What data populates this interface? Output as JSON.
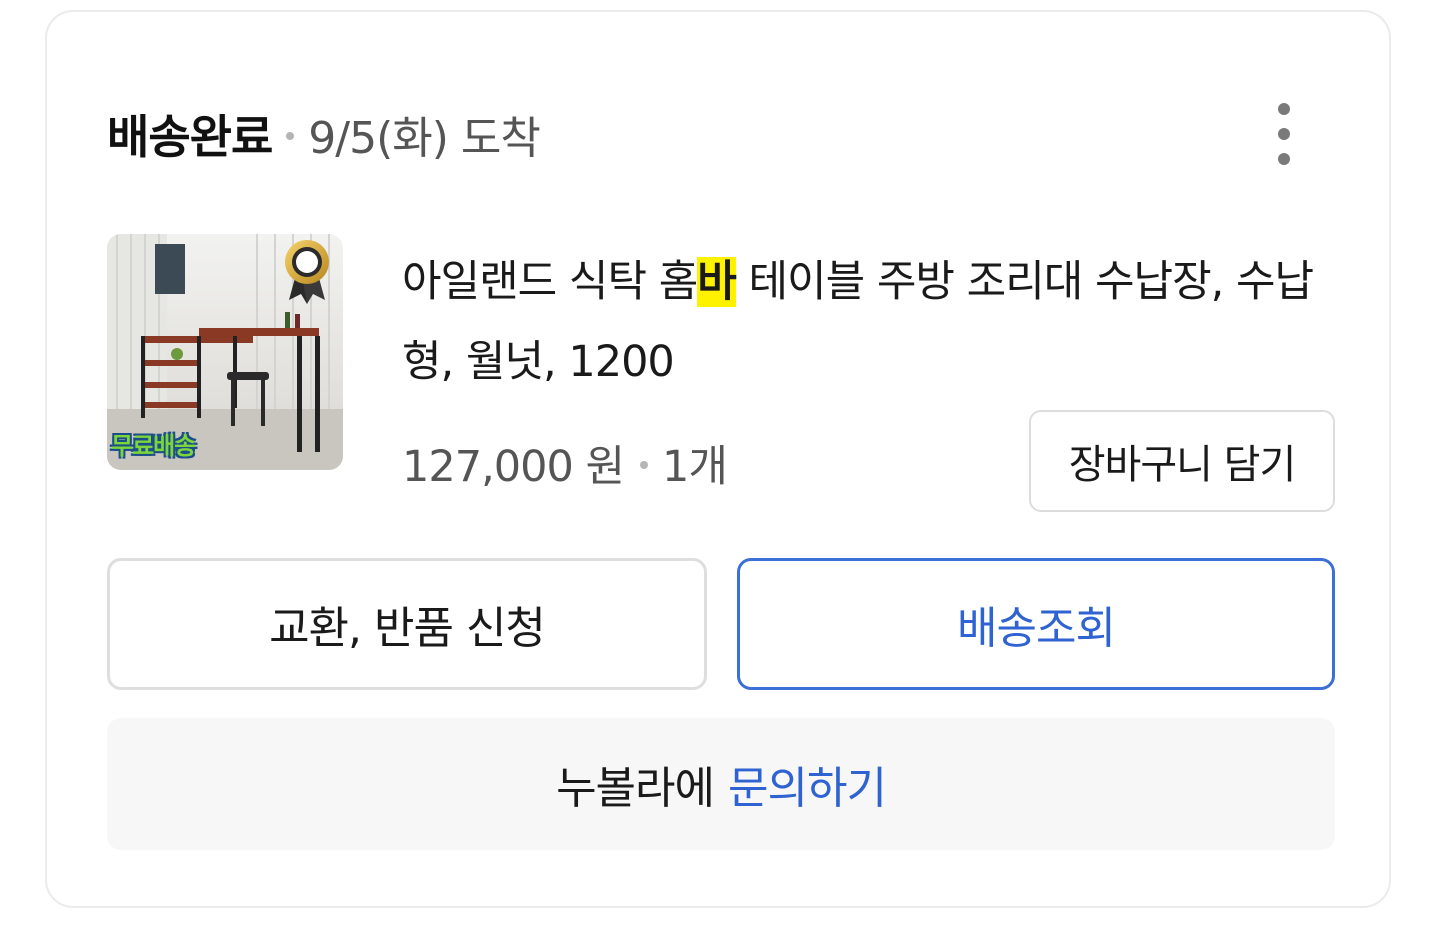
{
  "order": {
    "status": "배송완료",
    "arrival": "9/5(화) 도착",
    "more_icon": "more-vertical-icon"
  },
  "product": {
    "name_before": "아일랜드 식탁 홈",
    "name_highlight": "바",
    "name_after": " 테이블 주방 조리대 수납장, 수납형, 월넛, 1200",
    "highlight_color": "#fff200",
    "price": "127,000 원",
    "quantity": "1개",
    "thumbnail_badge": "무료배송"
  },
  "buttons": {
    "cart": "장바구니 담기",
    "exchange_return": "교환, 반품 신청",
    "tracking": "배송조회"
  },
  "inquiry": {
    "prefix": "누볼라에",
    "link": "문의하기"
  },
  "colors": {
    "accent_blue": "#2f63d1",
    "border": "#dedede"
  }
}
